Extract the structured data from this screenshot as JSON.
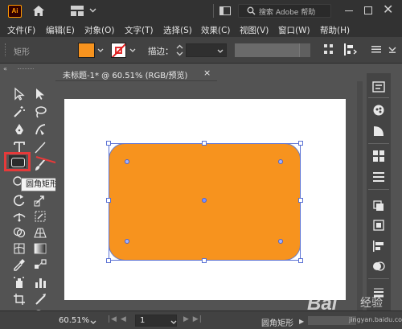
{
  "app": {
    "logo_text": "Ai",
    "search_placeholder": "搜索 Adobe 帮助",
    "brand_color": "#ff9a00"
  },
  "menu": [
    "文件(F)",
    "编辑(E)",
    "对象(O)",
    "文字(T)",
    "选择(S)",
    "效果(C)",
    "视图(V)",
    "窗口(W)",
    "帮助(H)"
  ],
  "control_bar": {
    "shape_label": "矩形",
    "fill_color": "#f7931e",
    "stroke_color": "none",
    "stroke_label": "描边：",
    "stroke_weight": ""
  },
  "document": {
    "tab_title": "未标题-1* @ 60.51% (RGB/预览)",
    "close_glyph": "×"
  },
  "tools": {
    "tooltip": "圆角矩形工具",
    "active_tool": "rounded-rectangle-tool"
  },
  "canvas": {
    "shape_fill": "#f7931e",
    "selection_color": "#5b72d4"
  },
  "status": {
    "zoom": "60.51%",
    "page": "1",
    "current_tool": "圆角矩形"
  },
  "watermark": {
    "brand": "Bai",
    "cn": "经验",
    "url": "jingyan.baidu.com"
  }
}
